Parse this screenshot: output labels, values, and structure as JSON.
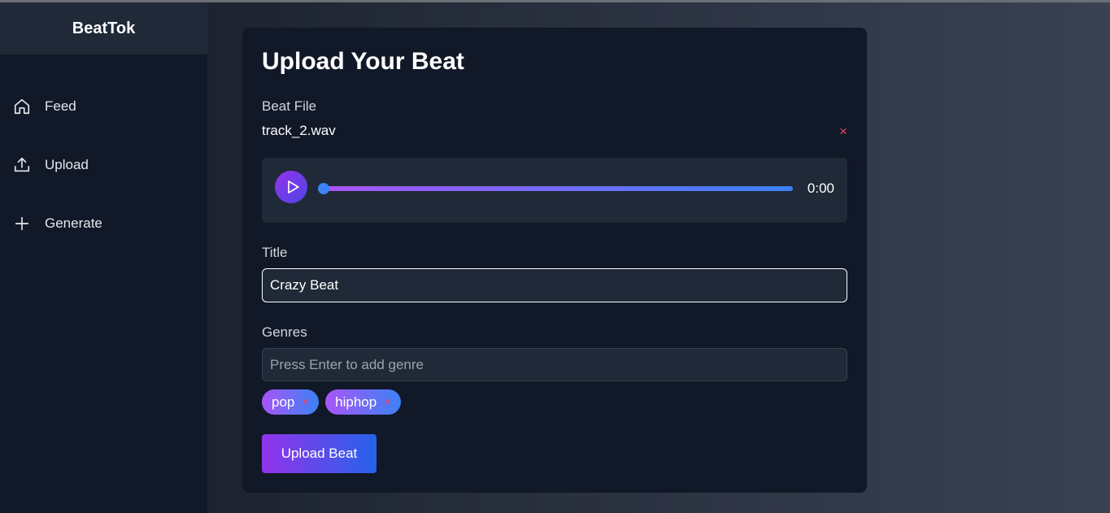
{
  "app": {
    "title": "BeatTok"
  },
  "sidebar": {
    "items": [
      {
        "label": "Feed",
        "icon": "home-icon"
      },
      {
        "label": "Upload",
        "icon": "upload-icon"
      },
      {
        "label": "Generate",
        "icon": "plus-icon"
      }
    ]
  },
  "form": {
    "heading": "Upload Your Beat",
    "beat_file_label": "Beat File",
    "file_name": "track_2.wav",
    "remove_file": "×",
    "player": {
      "time": "0:00",
      "progress": 0
    },
    "title_label": "Title",
    "title_value": "Crazy Beat",
    "genres_label": "Genres",
    "genres_placeholder": "Press Enter to add genre",
    "genres": [
      "pop",
      "hiphop"
    ],
    "genre_remove": "×",
    "submit_label": "Upload Beat"
  },
  "colors": {
    "background": "#111827",
    "panel": "#1f2937",
    "accent_purple": "#a855f7",
    "accent_blue": "#3b82f6",
    "remove_red": "#f43f5e"
  }
}
